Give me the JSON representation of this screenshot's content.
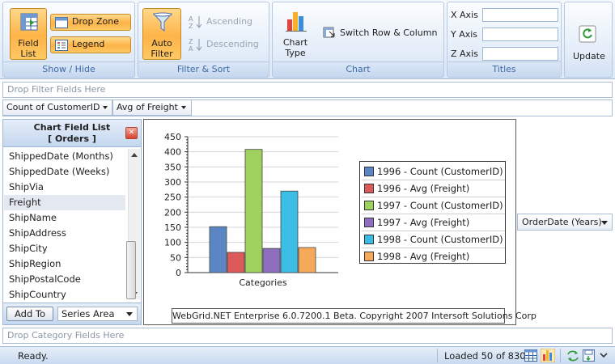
{
  "ribbon": {
    "groups": {
      "show_hide": {
        "label": "Show / Hide",
        "field_list_label": "Field\nList",
        "drop_zone_label": "Drop Zone",
        "legend_label": "Legend"
      },
      "filter_sort": {
        "label": "Filter & Sort",
        "auto_filter_label": "Auto\nFilter",
        "ascending_label": "Ascending",
        "descending_label": "Descending"
      },
      "chart": {
        "label": "Chart",
        "chart_type_label": "Chart\nType",
        "switch_label": "Switch Row & Column"
      },
      "titles": {
        "label": "Titles",
        "x_axis_label": "X Axis",
        "y_axis_label": "Y Axis",
        "z_axis_label": "Z Axis",
        "x_axis_value": "",
        "y_axis_value": "",
        "z_axis_value": ""
      },
      "update": {
        "label": "Update"
      }
    }
  },
  "drop_filter_placeholder": "Drop Filter Fields Here",
  "data_fields": [
    {
      "label": "Count of CustomerID"
    },
    {
      "label": "Avg of Freight"
    }
  ],
  "field_list": {
    "title": "Chart Field List",
    "subtitle": "[ Orders ]",
    "items": [
      "ShippedDate (Months)",
      "ShippedDate (Weeks)",
      "ShipVia",
      "Freight",
      "ShipName",
      "ShipAddress",
      "ShipCity",
      "ShipRegion",
      "ShipPostalCode",
      "ShipCountry"
    ],
    "selected_item": "Freight",
    "add_to_label": "Add To",
    "area_select_value": "Series Area"
  },
  "chart_data": {
    "type": "bar",
    "categories": [
      "Categories"
    ],
    "xlabel": "Categories",
    "ylabel": "",
    "ylim": [
      0,
      450
    ],
    "yticks": [
      0,
      50,
      100,
      150,
      200,
      250,
      300,
      350,
      400,
      450
    ],
    "grid": true,
    "legend_position": "right",
    "series": [
      {
        "name": "1996 - Count (CustomerID)",
        "values": [
          152
        ],
        "color": "#5b86c3"
      },
      {
        "name": "1996 - Avg (Freight)",
        "values": [
          67
        ],
        "color": "#dc5a5a"
      },
      {
        "name": "1997 - Count (CustomerID)",
        "values": [
          408
        ],
        "color": "#9fd15f"
      },
      {
        "name": "1997 - Avg (Freight)",
        "values": [
          80
        ],
        "color": "#8e6fbf"
      },
      {
        "name": "1998 - Count (CustomerID)",
        "values": [
          270
        ],
        "color": "#3cbde3"
      },
      {
        "name": "1998 - Avg (Freight)",
        "values": [
          83
        ],
        "color": "#f6a95b"
      }
    ]
  },
  "copyright": "WebGrid.NET Enterprise 6.0.7200.1 Beta. Copyright 2007 Intersoft Solutions Corp",
  "series_field": {
    "label": "OrderDate (Years)"
  },
  "drop_category_placeholder": "Drop Category Fields Here",
  "status": {
    "text": "Ready.",
    "loaded": "Loaded 50 of 830"
  }
}
